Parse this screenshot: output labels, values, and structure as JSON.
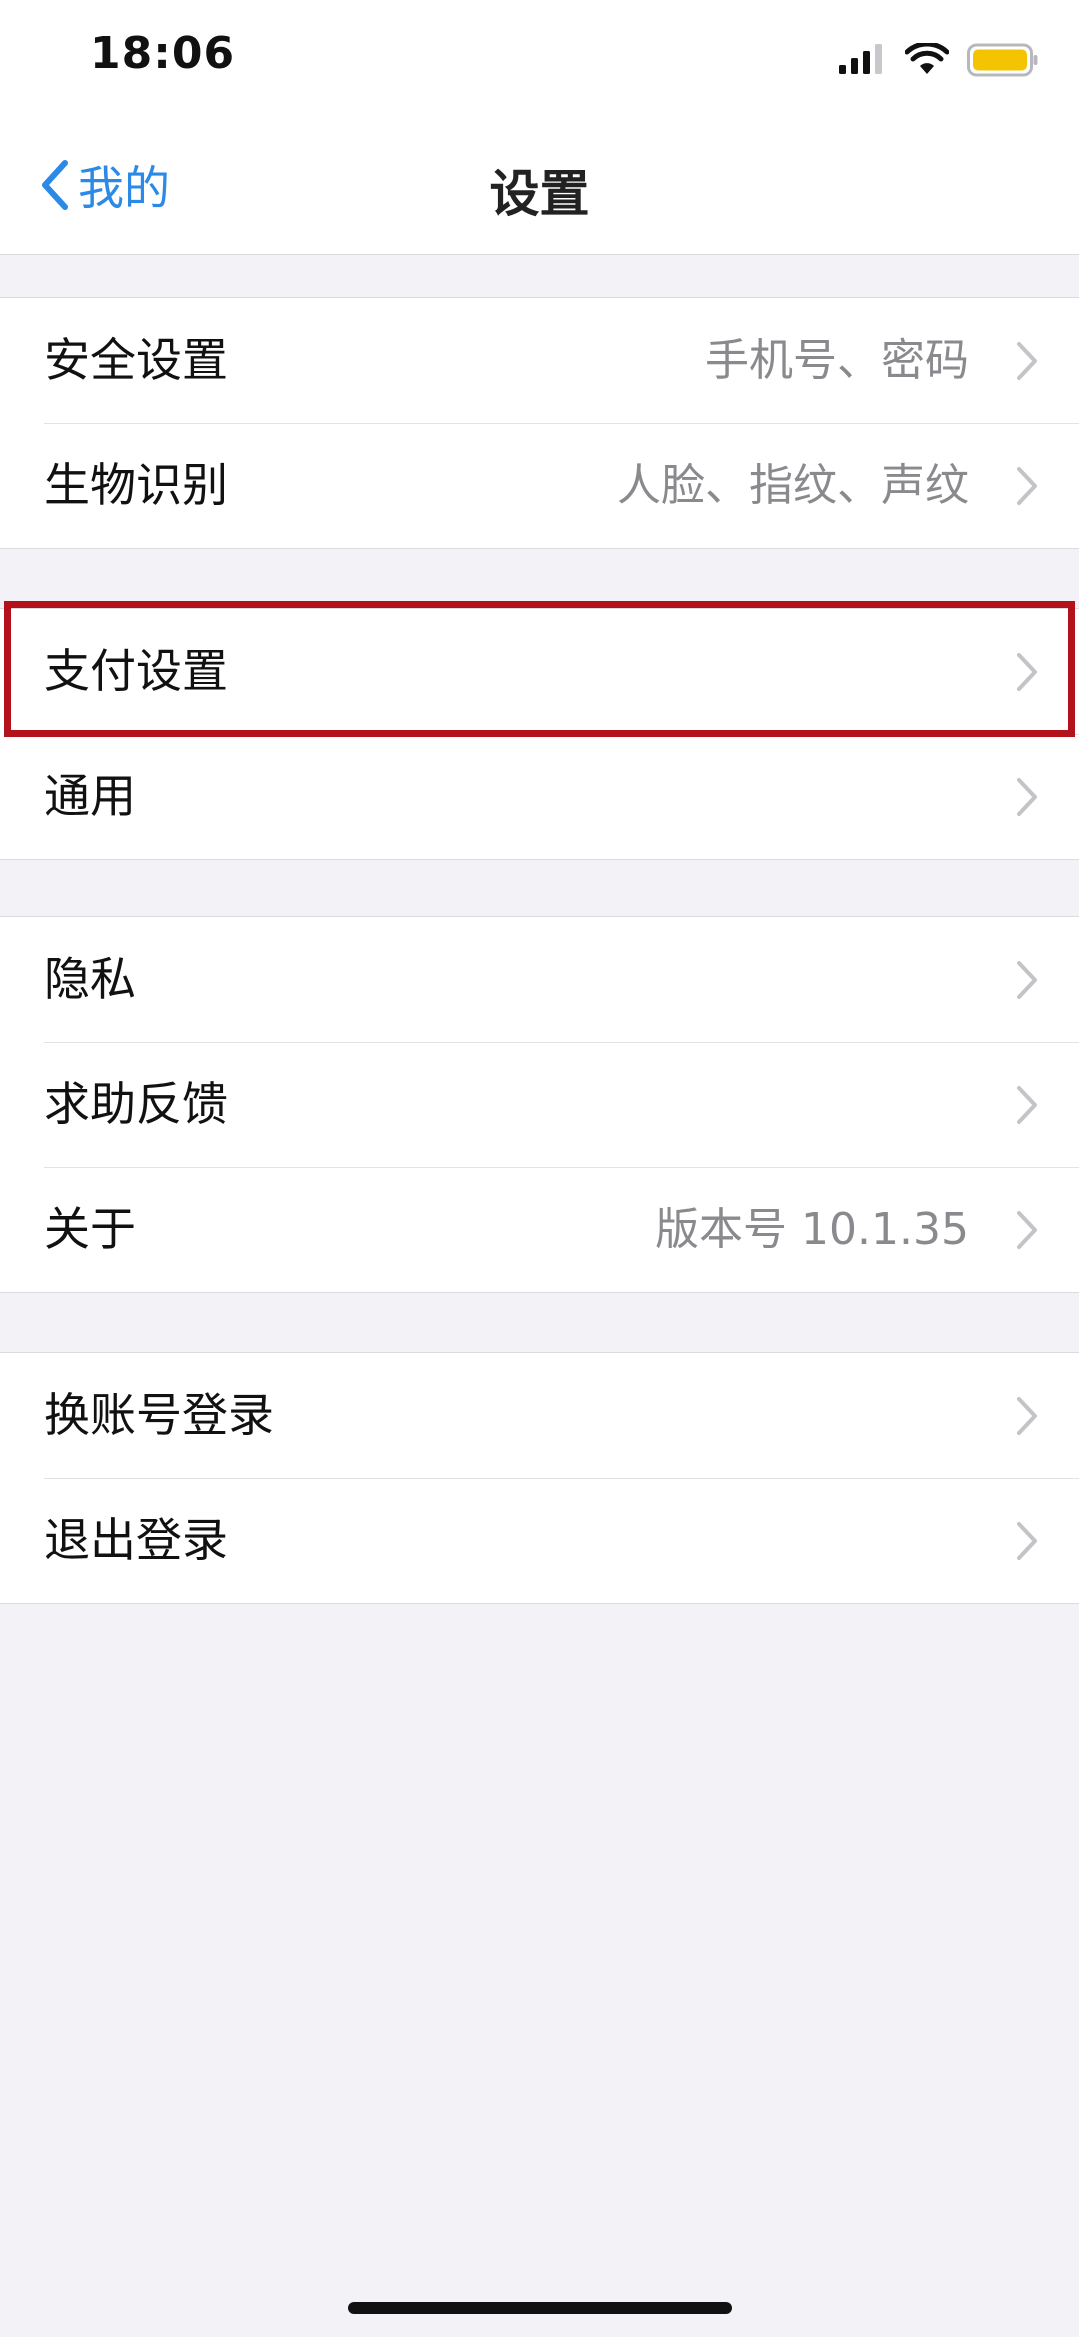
{
  "status_bar": {
    "time": "18:06"
  },
  "nav": {
    "back_label": "我的",
    "title": "设置"
  },
  "groups": [
    {
      "rows": [
        {
          "label": "安全设置",
          "value": "手机号、密码"
        },
        {
          "label": "生物识别",
          "value": "人脸、指纹、声纹"
        }
      ]
    },
    {
      "rows": [
        {
          "label": "支付设置",
          "value": ""
        },
        {
          "label": "通用",
          "value": ""
        }
      ]
    },
    {
      "rows": [
        {
          "label": "隐私",
          "value": ""
        },
        {
          "label": "求助反馈",
          "value": ""
        },
        {
          "label": "关于",
          "value": "版本号 10.1.35"
        }
      ]
    },
    {
      "rows": [
        {
          "label": "换账号登录",
          "value": ""
        },
        {
          "label": "退出登录",
          "value": ""
        }
      ]
    }
  ],
  "colors": {
    "accent": "#2a8ae6",
    "highlight_border": "#b3121c",
    "battery": "#f5c400"
  }
}
